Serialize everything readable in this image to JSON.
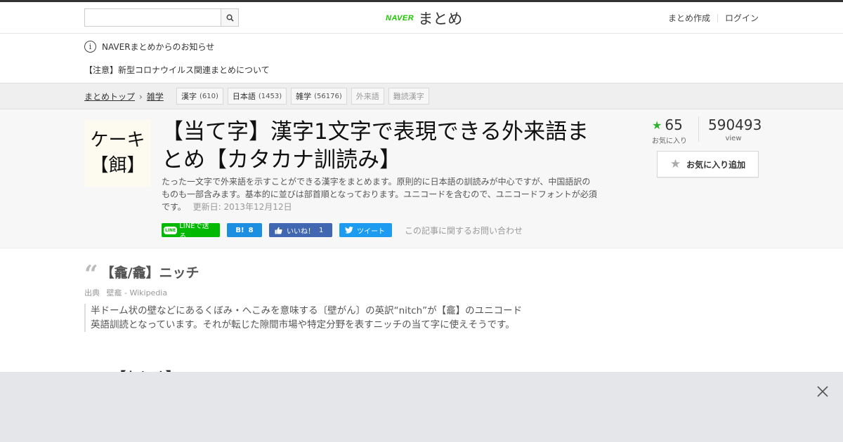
{
  "header": {
    "search_placeholder": "",
    "logo_brand": "NAVER",
    "logo_text": "まとめ",
    "links": [
      "まとめ作成",
      "ログイン"
    ]
  },
  "notice": {
    "title": "NAVERまとめからのお知らせ",
    "item": "【注意】新型コロナウイルス関連まとめについて"
  },
  "breadcrumb": {
    "items": [
      "まとめトップ",
      "雑学"
    ]
  },
  "tags": [
    {
      "label": "漢字",
      "count": "(610)"
    },
    {
      "label": "日本語",
      "count": "(1453)"
    },
    {
      "label": "雑学",
      "count": "(56176)"
    },
    {
      "label": "外来語",
      "count": ""
    },
    {
      "label": "難読漢字",
      "count": ""
    }
  ],
  "thumbnail": {
    "line1": "ケーキ",
    "line2": "【餌】"
  },
  "article": {
    "title": "【当て字】漢字1文字で表現できる外来語まとめ【カタカナ訓読み】",
    "description": "たった一文字で外来語を示すことができる漢字をまとめます。原則的に日本語の訓読みが中心ですが、中国語訳のものも一部含みます。基本的に並びは部首順となっております。ユニコードを含むので、ユニコードフォントが必須です。",
    "updated": "更新日: 2013年12月12日"
  },
  "share": {
    "line_badge": "LINE",
    "line_label": "LINEで送る",
    "hatena_icon": "B!",
    "hatena_count": "8",
    "fb_label": "いいね！",
    "fb_count": "1",
    "tw_label": "ツイート",
    "inquiry": "この記事に関するお問い合わせ"
  },
  "stats": {
    "favorites": "65",
    "favorites_label": "お気に入り",
    "views": "590493",
    "views_label": "view",
    "add_favorite": "お気に入り追加"
  },
  "content": {
    "heading": "【龕/龕】ニッチ",
    "source_label": "出典",
    "source_text": "壁龕 - Wikipedia",
    "quote": "半ドーム状の壁などにあるくぼみ・へこみを意味する〔壁がん〕の英訳“nitch”が【龕】のユニコード英語訓読となっています。それが転じた隙間市場や特定分野を表すニッチの当て字に使えそうです。",
    "next_heading": "【おとめ】"
  },
  "colors": {
    "brand_green": "#1ec800",
    "star_green": "#2fb12f",
    "line_green": "#00b900",
    "hatena_blue": "#1d8fe1",
    "fb_blue": "#4267b2",
    "twitter_blue": "#1d9bf0"
  }
}
